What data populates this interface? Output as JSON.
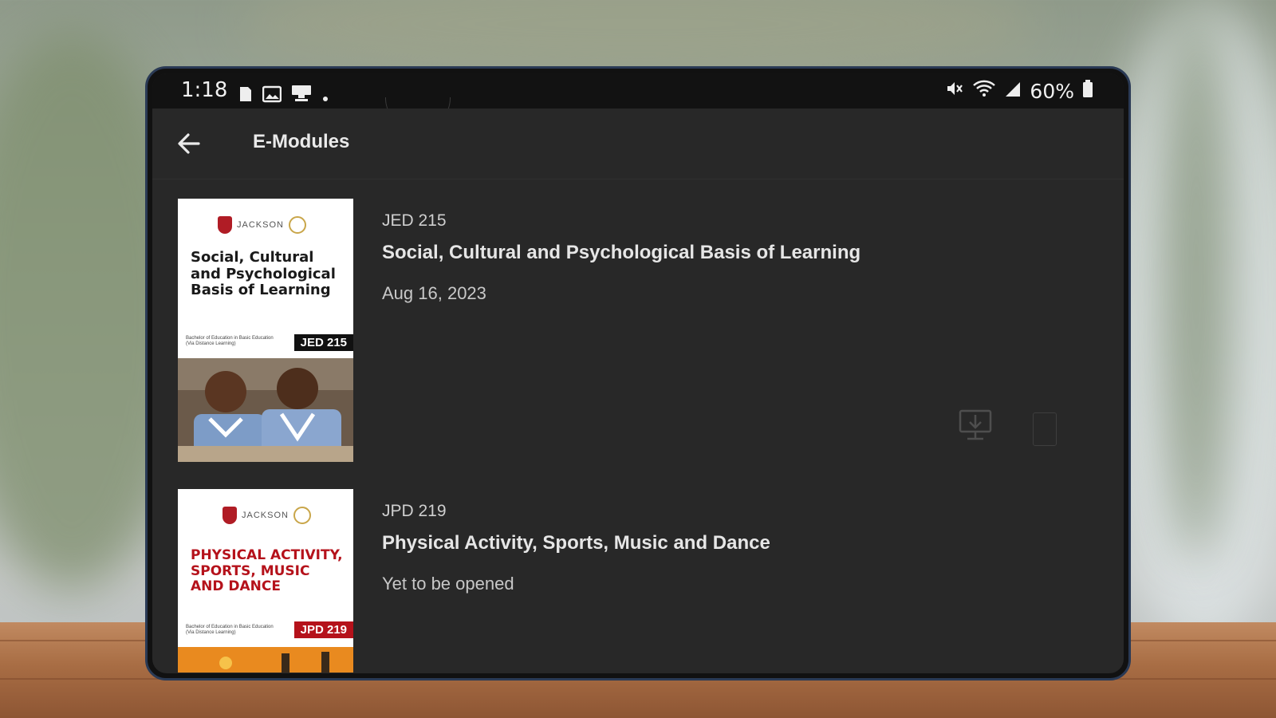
{
  "status_bar": {
    "time": "1:18",
    "battery": "60%",
    "left_icons": [
      "sim-icon",
      "image-icon",
      "cast-icon",
      "dot-icon"
    ],
    "right_icons": [
      "mute-icon",
      "wifi-icon",
      "signal-icon",
      "battery-icon"
    ]
  },
  "app_bar": {
    "title": "E-Modules",
    "back_icon": "arrow-left-icon"
  },
  "modules": [
    {
      "code": "JED 215",
      "title": "Social, Cultural and Psychological Basis of Learning",
      "status": "Aug 16, 2023",
      "cover": {
        "logo_text": "JACKSON",
        "title": "Social, Cultural and Psychological Basis of Learning",
        "code": "JED 215",
        "fineprint": "Bachelor of Education in Basic Education (Via Distance Learning)",
        "title_color": "#1a1a1a",
        "code_bg": "#111111"
      }
    },
    {
      "code": "JPD 219",
      "title": "Physical Activity, Sports, Music and Dance",
      "status": "Yet to be opened",
      "cover": {
        "logo_text": "JACKSON",
        "title": "PHYSICAL ACTIVITY, SPORTS, MUSIC AND DANCE",
        "code": "JPD 219",
        "fineprint": "Bachelor of Education in Basic Education (Via Distance Learning)",
        "title_color": "#b5121b",
        "code_bg": "#b5121b"
      }
    }
  ],
  "actions": {
    "download_icon": "download-to-device-icon",
    "secondary_icon": "phone-outline-icon"
  },
  "colors": {
    "screen_bg": "#282828",
    "status_bg": "#121212",
    "accent_red": "#b5121b"
  }
}
